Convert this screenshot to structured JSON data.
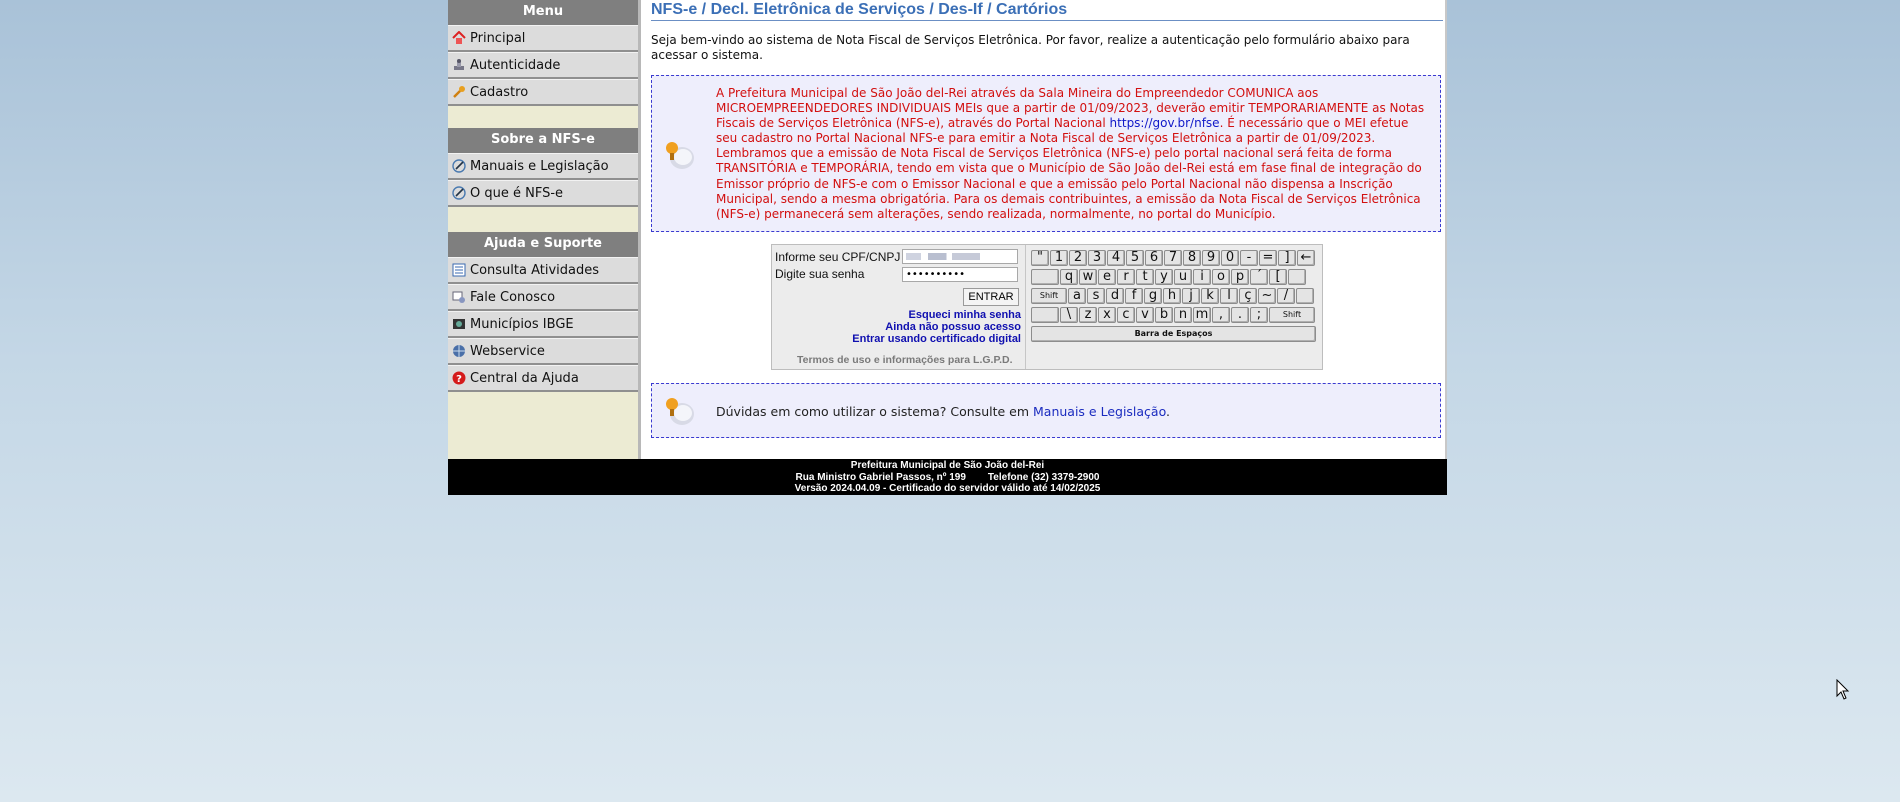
{
  "sidebar": {
    "menu": {
      "header": "Menu",
      "items": [
        {
          "label": "Principal",
          "icon": "home-icon"
        },
        {
          "label": "Autenticidade",
          "icon": "stamp-icon"
        },
        {
          "label": "Cadastro",
          "icon": "key-icon"
        }
      ]
    },
    "sobre": {
      "header": "Sobre a NFS-e",
      "items": [
        {
          "label": "Manuais e Legislação",
          "icon": "pen-icon"
        },
        {
          "label": "O que é NFS-e",
          "icon": "pen-icon"
        }
      ]
    },
    "ajuda": {
      "header": "Ajuda e Suporte",
      "items": [
        {
          "label": "Consulta Atividades",
          "icon": "list-icon"
        },
        {
          "label": "Fale Conosco",
          "icon": "contact-icon"
        },
        {
          "label": "Municípios IBGE",
          "icon": "flag-icon"
        },
        {
          "label": "Webservice",
          "icon": "globe-icon"
        },
        {
          "label": "Central da Ajuda",
          "icon": "help-icon"
        }
      ]
    }
  },
  "main": {
    "title": "NFS-e / Decl. Eletrônica de Serviços / Des-If / Cartórios",
    "welcome": "Seja bem-vindo ao sistema de Nota Fiscal de Serviços Eletrônica. Por favor, realize a autenticação pelo formulário abaixo para acessar o sistema.",
    "notice": {
      "text_before": "A Prefeitura Municipal de São João del-Rei através da Sala Mineira do Empreendedor COMUNICA aos MICROEMPREENDEDORES INDIVIDUAIS MEIs que a partir de 01/09/2023, deverão emitir TEMPORARIAMENTE as Notas Fiscais de Serviços Eletrônica (NFS-e), através do Portal Nacional ",
      "link": "https://gov.br/nfse",
      "text_after": ". É necessário que o MEI efetue seu cadastro no Portal Nacional NFS-e para emitir a Nota Fiscal de Serviços Eletrônica a partir de 01/09/2023. Lembramos que a emissão de Nota Fiscal de Serviços Eletrônica (NFS-e) pelo portal nacional será feita de forma TRANSITÓRIA e TEMPORÁRIA, tendo em vista que o Município de São João del-Rei está em fase final de integração do Emissor próprio de NFS-e com o Emissor Nacional e que a emissão pelo Portal Nacional não dispensa a Inscrição Municipal, sendo a mesma obrigatória. Para os demais contribuintes, a emissão da Nota Fiscal de Serviços Eletrônica (NFS-e) permanecerá sem alterações, sendo realizada, normalmente, no portal do Município."
    },
    "login": {
      "cpf_label": "Informe seu CPF/CNPJ",
      "cpf_value": "",
      "senha_label": "Digite sua senha",
      "senha_value": "••••••••••",
      "entrar": "ENTRAR",
      "forgot": "Esqueci minha senha",
      "no_access": "Ainda não possuo acesso",
      "certificate": "Entrar usando certificado digital",
      "terms": "Termos de uso e informações para L.G.P.D."
    },
    "keyboard": {
      "row1": [
        "\"",
        "1",
        "2",
        "3",
        "4",
        "5",
        "6",
        "7",
        "8",
        "9",
        "0",
        "-",
        "=",
        "]",
        "←"
      ],
      "row2": [
        "",
        "q",
        "w",
        "e",
        "r",
        "t",
        "y",
        "u",
        "i",
        "o",
        "p",
        "´",
        "[",
        ""
      ],
      "row3": [
        "Shift",
        "a",
        "s",
        "d",
        "f",
        "g",
        "h",
        "j",
        "k",
        "l",
        "ç",
        "~",
        "/",
        ""
      ],
      "row4": [
        "",
        "\\",
        "z",
        "x",
        "c",
        "v",
        "b",
        "n",
        "m",
        ",",
        ".",
        ";",
        "Shift"
      ],
      "space": "Barra de Espaços"
    },
    "help_notice": {
      "text": "Dúvidas em como utilizar o sistema? Consulte em ",
      "link": "Manuais e Legislação",
      "end": "."
    }
  },
  "footer": {
    "line1": "Prefeitura Municipal de São João del-Rei",
    "address": "Rua Ministro Gabriel Passos, nº 199",
    "phone": "Telefone (32) 3379-2900",
    "line3": "Versão 2024.04.09 - Certificado do servidor válido até 14/02/2025"
  }
}
